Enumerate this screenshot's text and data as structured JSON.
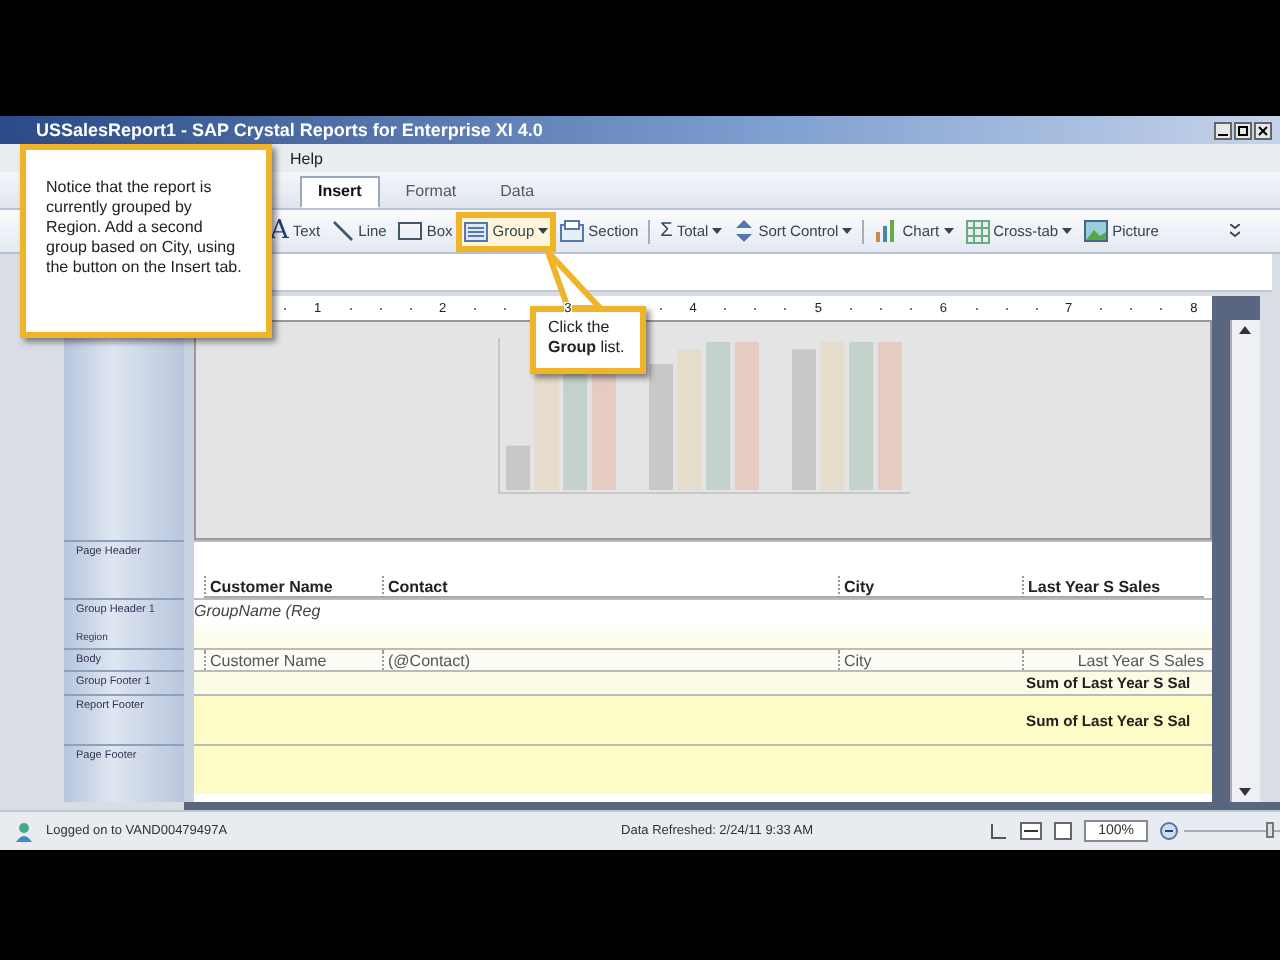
{
  "window": {
    "title": "USSalesReport1 - SAP Crystal Reports for Enterprise XI 4.0"
  },
  "menu": [
    "Help"
  ],
  "tabs": [
    {
      "label": "Insert",
      "selected": true
    },
    {
      "label": "Format",
      "selected": false
    },
    {
      "label": "Data",
      "selected": false
    }
  ],
  "toolbar": [
    {
      "kind": "text",
      "symbol": "A",
      "label": "Text",
      "dropdown": false,
      "highlighted": false
    },
    {
      "kind": "line",
      "label": "Line",
      "dropdown": false,
      "highlighted": false
    },
    {
      "kind": "box",
      "label": "Box",
      "dropdown": false,
      "highlighted": false
    },
    {
      "kind": "group",
      "label": "Group",
      "dropdown": true,
      "highlighted": true
    },
    {
      "kind": "section",
      "label": "Section",
      "dropdown": false,
      "highlighted": false
    },
    {
      "kind": "total",
      "symbol": "Σ",
      "label": "Total",
      "dropdown": true,
      "highlighted": false
    },
    {
      "kind": "sort",
      "label": "Sort Control",
      "dropdown": true,
      "highlighted": false
    },
    {
      "kind": "chart",
      "label": "Chart",
      "dropdown": true,
      "highlighted": false
    },
    {
      "kind": "crosstab",
      "label": "Cross-tab",
      "dropdown": true,
      "highlighted": false
    },
    {
      "kind": "picture",
      "label": "Picture",
      "dropdown": false,
      "highlighted": false
    }
  ],
  "ruler": [
    "1",
    "2",
    "3",
    "4",
    "5",
    "6",
    "7",
    "8"
  ],
  "sections": [
    {
      "kind": "header",
      "name": "Page Header",
      "cells": [
        "Customer Name",
        "Contact",
        "City",
        "Last Year S Sales"
      ]
    },
    {
      "kind": "group",
      "name": "Group Header 1",
      "subtitle": "Region",
      "value": "GroupName (Reg"
    },
    {
      "kind": "body",
      "name": "Body",
      "cells": [
        "Customer Name",
        "(@Contact)",
        "City",
        "Last Year S Sales"
      ]
    },
    {
      "kind": "summary",
      "name": "Group Footer 1",
      "value": "Sum of Last Year S Sal"
    },
    {
      "kind": "summary",
      "name": "Report Footer",
      "value": "Sum of Last Year S Sal"
    },
    {
      "kind": "empty",
      "name": "Page Footer"
    }
  ],
  "status_bar": {
    "user": "Logged on to VAND00479497A",
    "refreshed": "Data Refreshed: 2/24/11 9:33 AM",
    "zoom": "100%",
    "zoom_slider": {
      "level": 0.9
    }
  },
  "callouts": [
    {
      "text": "Notice that the report is currently grouped by Region. Add a second group based on City, using the button on the Insert tab."
    },
    {
      "text": "Click the **Group** list."
    }
  ]
}
